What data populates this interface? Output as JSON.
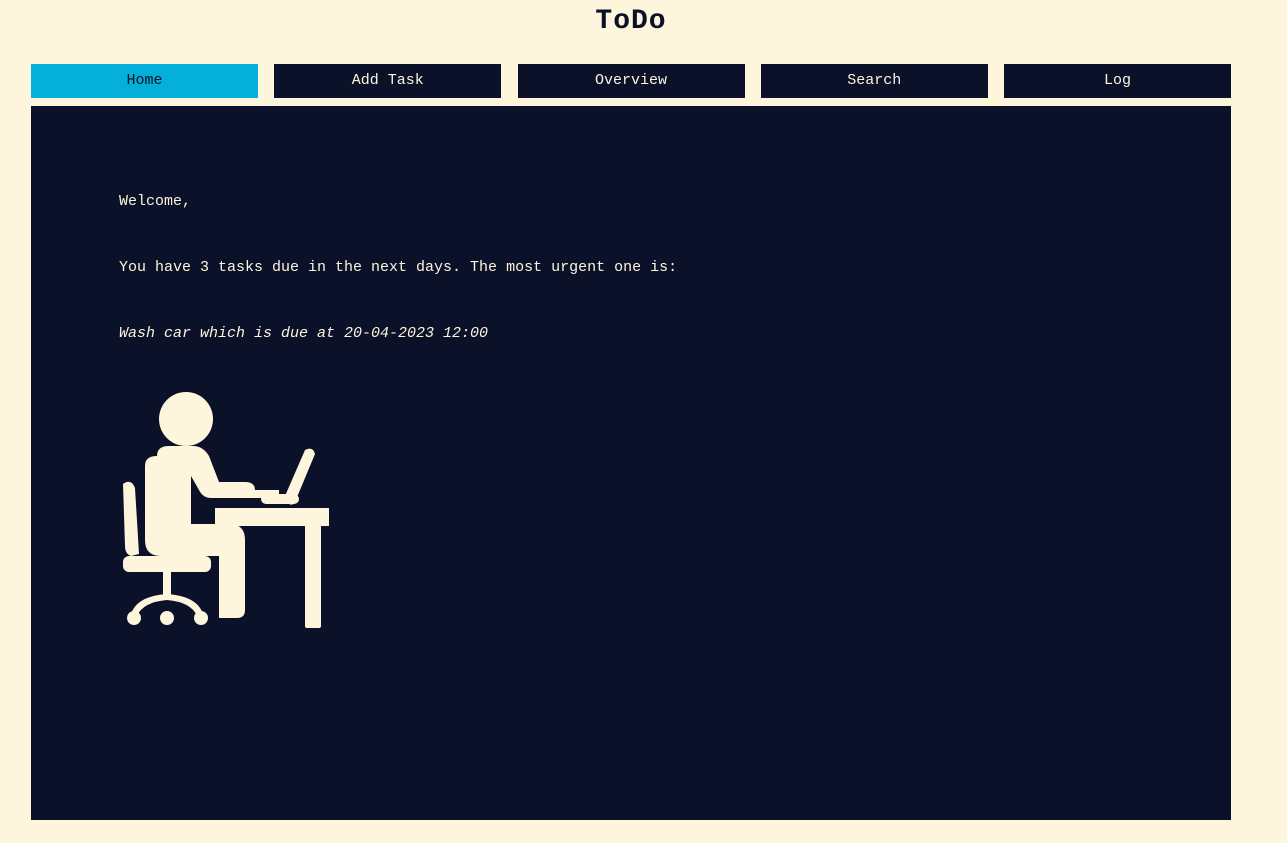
{
  "app": {
    "title": "ToDo"
  },
  "nav": {
    "items": [
      {
        "label": "Home",
        "active": true
      },
      {
        "label": "Add Task",
        "active": false
      },
      {
        "label": "Overview",
        "active": false
      },
      {
        "label": "Search",
        "active": false
      },
      {
        "label": "Log",
        "active": false
      }
    ]
  },
  "main": {
    "welcome": "Welcome,",
    "summary": "You have 3 tasks due in the next days. The most urgent one is:",
    "urgent_task": "Wash car which is due at 20-04-2023 12:00",
    "illustration": "person-at-desk-icon"
  },
  "colors": {
    "background": "#fdf5dc",
    "panel": "#0a1128",
    "accent": "#04afd9",
    "text_light": "#fdf5dc"
  }
}
